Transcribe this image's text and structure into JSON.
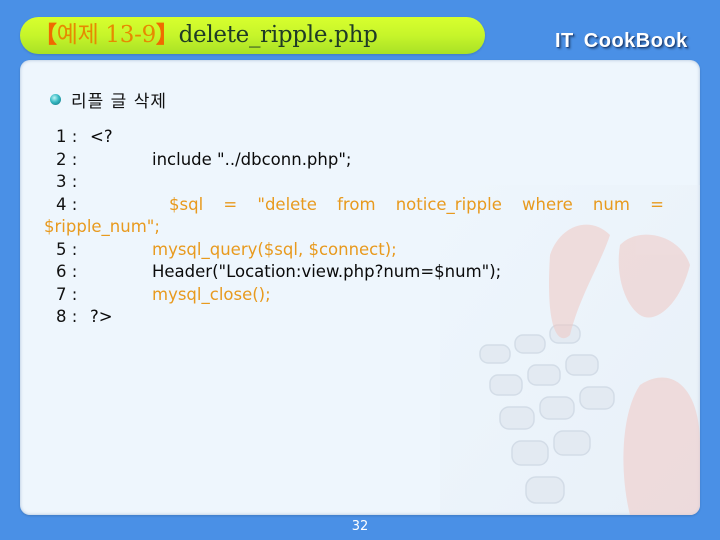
{
  "header": {
    "bracket_open": "【",
    "example_label": "예제 13-9",
    "bracket_close": "】",
    "filename": "delete_ripple.php",
    "brand_left": "IT",
    "brand_right": "CookBook"
  },
  "content": {
    "subtitle": "리플 글 삭제",
    "code_lines": [
      {
        "num": "1 : ",
        "text": "<?",
        "color": "black"
      },
      {
        "num": "2 : ",
        "text": "include \"../dbconn.php\";",
        "color": "black"
      },
      {
        "num": "3 : ",
        "text": "",
        "color": "black"
      },
      {
        "num": "4 : ",
        "tokens": [
          "$sql",
          "=",
          "\"delete",
          "from",
          "notice_ripple",
          "where",
          "num",
          "="
        ],
        "continuation": "$ripple_num\";",
        "color": "orange"
      },
      {
        "num": "5 : ",
        "text": "mysql_query($sql, $connect);",
        "color": "orange"
      },
      {
        "num": "6 : ",
        "text": "Header(\"Location:view.php?num=$num\");",
        "color": "black"
      },
      {
        "num": "7 : ",
        "text": "mysql_close();",
        "color": "orange"
      },
      {
        "num": "8 : ",
        "text": "?>",
        "color": "black"
      }
    ]
  },
  "footer": {
    "page_number": "32"
  },
  "colors": {
    "background": "#4a90e6",
    "banner": "#c6f52a",
    "code_orange": "#e89a1e",
    "panel": "#eef6fd"
  }
}
